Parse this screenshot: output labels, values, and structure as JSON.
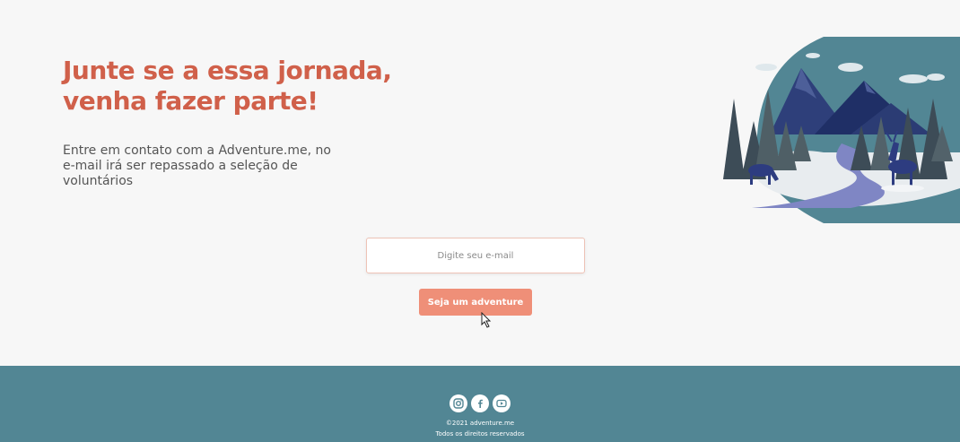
{
  "hero": {
    "title_line1": "Junte se a essa jornada,",
    "title_line2": "venha fazer parte!",
    "text": "Entre em contato com a Adventure.me, no e-mail irá ser repassado a seleção de voluntários"
  },
  "form": {
    "email_placeholder": "Digite seu e-mail",
    "button_label": "Seja um adventure"
  },
  "footer": {
    "social": [
      "instagram-icon",
      "facebook-icon",
      "youtube-icon"
    ],
    "copyright": "©2021 adventure.me",
    "rights": "Todos os direitos reservados"
  },
  "colors": {
    "accent": "#d0604a",
    "button": "#ef8f78",
    "footer": "#528694",
    "background": "#f7f7f7"
  }
}
